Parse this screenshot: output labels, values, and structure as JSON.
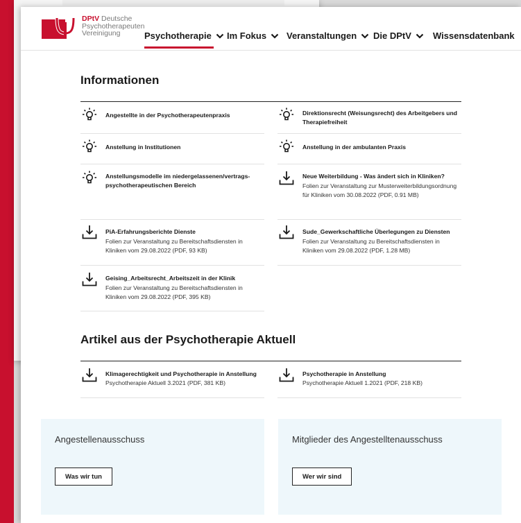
{
  "logo": {
    "brand": "DPtV",
    "line1": "Deutsche",
    "line2": "Psychotherapeuten",
    "line3": "Vereinigung"
  },
  "nav": {
    "items": [
      "Psychotherapie",
      "Im Fokus",
      "Veranstaltungen",
      "Die DPtV",
      "Wissensdatenbank"
    ],
    "active": "Psychotherapie"
  },
  "colors": {
    "brand_red": "#c8102e",
    "panel_bg": "#eef7fb"
  },
  "informationen": {
    "heading": "Informationen",
    "items": [
      {
        "icon": "lightbulb-icon",
        "title": "Angestellte in der Psychotherapeutenpraxis",
        "desc": ""
      },
      {
        "icon": "lightbulb-icon",
        "title": "Direktionsrecht (Weisungsrecht) des Arbeitgebers und Therapiefreiheit",
        "desc": ""
      },
      {
        "icon": "lightbulb-icon",
        "title": "Anstellung in Institutionen",
        "desc": ""
      },
      {
        "icon": "lightbulb-icon",
        "title": "Anstellung in der ambulanten Praxis",
        "desc": ""
      },
      {
        "icon": "lightbulb-icon",
        "title": "Anstellungsmodelle im niedergelassenen/vertrags-psychotherapeutischen Bereich",
        "desc": ""
      },
      {
        "icon": "download-icon",
        "title": "Neue Weiterbildung - Was ändert sich in Kliniken?",
        "desc": "Folien zur Veranstaltung zur Musterweiterbildungsordnung für Kliniken vom 30.08.2022 (PDF, 0.91 MB)"
      },
      {
        "icon": "download-icon",
        "title": "PiA-Erfahrungsberichte Dienste",
        "desc": "Folien zur Veranstaltung zu Bereitschaftsdiensten in Kliniken vom 29.08.2022 (PDF, 93 KB)"
      },
      {
        "icon": "download-icon",
        "title": "Sude_Gewerkschaftliche Überlegungen zu Diensten",
        "desc": "Folien zur Veranstaltung zu Bereitschaftsdiensten in Kliniken vom 29.08.2022 (PDF, 1.28 MB)"
      },
      {
        "icon": "download-icon",
        "title": "Geising_Arbeitsrecht_Arbeitszeit in der Klinik",
        "desc": "Folien zur Veranstaltung zu Bereitschaftsdiensten in Kliniken vom 29.08.2022 (PDF, 395 KB)"
      }
    ]
  },
  "artikel": {
    "heading": "Artikel aus der Psychotherapie Aktuell",
    "items": [
      {
        "icon": "download-icon",
        "title": "Klimagerechtigkeit und Psychotherapie in Anstellung",
        "desc": "Psychotherapie Aktuell 3.2021 (PDF, 381 KB)"
      },
      {
        "icon": "download-icon",
        "title": "Psychotherapie in Anstellung",
        "desc": "Psychotherapie Aktuell 1.2021 (PDF, 218 KB)"
      }
    ]
  },
  "panels": [
    {
      "title": "Angestellenausschuss",
      "button": "Was wir tun"
    },
    {
      "title": "Mitglieder des Angestelltenausschuss",
      "button": "Wer wir sind"
    }
  ]
}
